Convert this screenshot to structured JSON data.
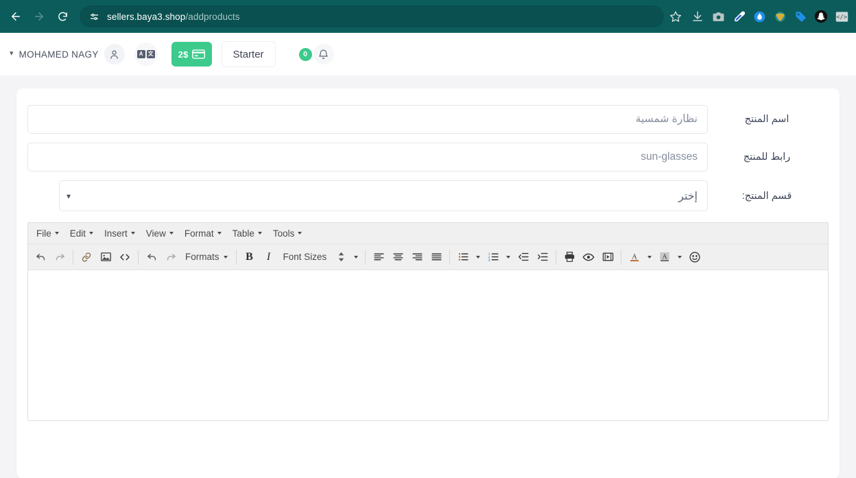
{
  "browser": {
    "back_icon": "arrow-left-icon",
    "forward_icon": "arrow-right-icon",
    "reload_icon": "reload-icon",
    "site_settings_icon": "tune-icon",
    "url_domain": "sellers.baya3.shop",
    "url_path": "/addproducts",
    "bookmark_icon": "star-icon",
    "extensions": [
      {
        "name": "download-icon",
        "title": "Downloads"
      },
      {
        "name": "screenshot-camera-icon",
        "title": "Screenshot"
      },
      {
        "name": "eyedropper-icon",
        "title": "Color picker"
      },
      {
        "name": "water-drop-icon",
        "title": "Extension"
      },
      {
        "name": "idm-globe-icon",
        "title": "IDM"
      },
      {
        "name": "tag-icon",
        "title": "Coupons"
      },
      {
        "name": "snapchat-icon",
        "title": "Snapchat"
      },
      {
        "name": "code-icon",
        "title": "Developer"
      }
    ]
  },
  "header": {
    "user_name": "MOHAMED NAGY",
    "user_caret_icon": "chevron-down-icon",
    "avatar_icon": "person-icon",
    "translate_icon": "translate-icon",
    "translate_letter_a": "A",
    "translate_letter_b": "文",
    "balance_amount": "2$",
    "balance_icon": "credit-card-icon",
    "plan_label": "Starter",
    "notification_count": "0",
    "bell_icon": "bell-icon"
  },
  "form": {
    "fields": [
      {
        "label": "اسم المنتج",
        "value": "نظارة شمسية",
        "placeholder": "نظارة شمسية"
      },
      {
        "label": "رابط للمنتج",
        "value": "sun-glasses",
        "placeholder": "sun-glasses"
      }
    ],
    "category": {
      "label": "قسم المنتج:",
      "selected": "إختر",
      "chevron_icon": "chevron-down-icon"
    }
  },
  "editor": {
    "menus": [
      {
        "label": "File"
      },
      {
        "label": "Edit"
      },
      {
        "label": "Insert"
      },
      {
        "label": "View"
      },
      {
        "label": "Format"
      },
      {
        "label": "Table"
      },
      {
        "label": "Tools"
      }
    ],
    "formats_label": "Formats",
    "font_sizes_label": "Font Sizes",
    "bold_label": "B",
    "italic_label": "I",
    "buttons": [
      "undo-icon",
      "redo-icon",
      "link-icon",
      "image-icon",
      "source-code-icon",
      "undo-icon",
      "redo-icon",
      "align-left-icon",
      "align-center-icon",
      "align-right-icon",
      "align-justify-icon",
      "bullet-list-icon",
      "numbered-list-icon",
      "outdent-icon",
      "indent-icon",
      "print-icon",
      "preview-icon",
      "media-icon",
      "text-color-icon",
      "background-color-icon",
      "emoticon-icon"
    ],
    "content": ""
  },
  "colors": {
    "browser_chrome": "#0d5c5c",
    "accent_green": "#3ccb8c",
    "page_background": "#f4f4f7",
    "card_background": "#ffffff",
    "label_text": "#3d4559",
    "input_border": "#e3e6ec",
    "editor_chrome": "#f0f0f0"
  }
}
